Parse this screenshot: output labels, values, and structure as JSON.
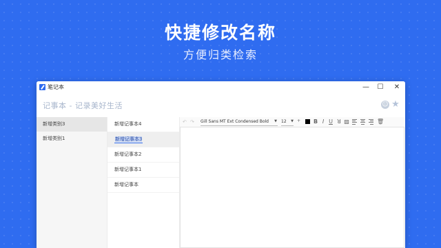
{
  "banner": {
    "title": "快捷修改名称",
    "subtitle": "方便归类检索"
  },
  "window": {
    "app_name": "笔记本",
    "controls": {
      "minimize": "—",
      "maximize": "☐",
      "close": "✕"
    },
    "header_title": "记事本 - 记录美好生活"
  },
  "categories": [
    {
      "label": "新增类别3",
      "selected": true
    },
    {
      "label": "新增类别1",
      "selected": false
    }
  ],
  "notes": [
    {
      "label": "新增记事本4",
      "editing": false
    },
    {
      "label": "新增记事本3",
      "editing": true
    },
    {
      "label": "新增记事本2",
      "editing": false
    },
    {
      "label": "新增记事本1",
      "editing": false
    },
    {
      "label": "新增记事本",
      "editing": false
    }
  ],
  "toolbar": {
    "undo_icon": "undo-icon",
    "redo_icon": "redo-icon",
    "font_family": "Gill Sans MT Ext Condensed Bold",
    "font_size": "12",
    "bold": "B",
    "italic": "I",
    "underline": "U",
    "text_color": "#000000"
  },
  "colors": {
    "background": "#2f6cf0",
    "accent": "#2f6cf0",
    "header_text": "#a8b6cc"
  }
}
